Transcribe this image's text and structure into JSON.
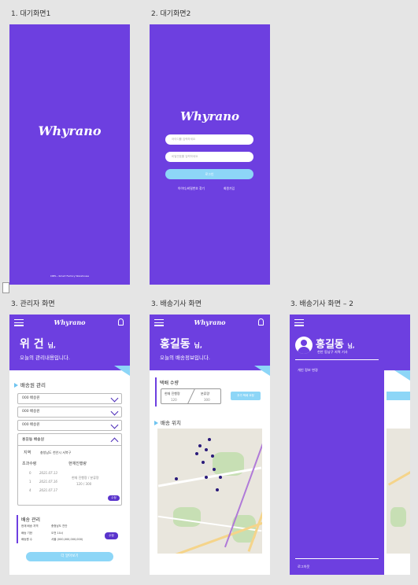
{
  "labels": {
    "s1": "1. 대기화면1",
    "s2": "2. 대기화면2",
    "s3": "3. 관리자 화면",
    "s4": "3. 배송기사 화면",
    "s5": "3. 배송기사 화면 – 2"
  },
  "app": {
    "logo": "Whyrano"
  },
  "splash": {
    "footer": "CREL...Smart Factory Warehouse"
  },
  "login": {
    "id_placeholder": "아이디를 입력하세요",
    "pw_placeholder": "비밀번호를 입력하세요",
    "login_button": "로그인",
    "find_link": "아이디/비밀번호 찾기",
    "signup_link": "회원가입"
  },
  "admin": {
    "name": "위 건",
    "suffix": "님,",
    "subtitle": "오늘의 관리내용입니다.",
    "section_drivers": "배송원 관리",
    "dropdowns": [
      "000 배송원",
      "000 배송원",
      "000 배송원"
    ],
    "expanded": {
      "title": "홍길동 배송원",
      "region_label": "지역",
      "region_value": "충청남도 천안시 서북구",
      "overtime_label": "초과수령",
      "progress_label": "현재진행량",
      "rows": [
        {
          "no": "0",
          "date": "2021.07.13"
        },
        {
          "no": "1",
          "date": "2021.07.16"
        },
        {
          "no": "4",
          "date": "2021.07.17"
        }
      ],
      "progress_head": "현재 진행량  /  분류량",
      "progress_vals": "120  /  300",
      "edit_button": "수정"
    },
    "section_delivery": "배송 관리",
    "delivery_lines": [
      {
        "k": "현재 배송 지역",
        "v": "충청남도 천안"
      },
      {
        "k": "배송 기한",
        "v": "오전 10시"
      },
      {
        "k": "배송원 수",
        "v": "서울 (000,000,000,000)"
      }
    ],
    "delivery_edit": "수정",
    "bottom_button": "더 알아보기"
  },
  "driver": {
    "name": "홍길동",
    "suffix": "님,",
    "subtitle": "오늘의 배송정보입니다.",
    "parcel_title": "택배 수량",
    "box_left_label": "현재 진행량",
    "box_left_val": "120",
    "box_right_label": "분류량",
    "box_right_val": "300",
    "request_button": "추가 택배 요청",
    "location_title": "배송 위치"
  },
  "drawer": {
    "name": "홍길동",
    "suffix": "님,",
    "region": "천안 동남구 지역 기사",
    "menu_item": "개인 정보 변경",
    "logout": "로그아웃"
  },
  "colors": {
    "primary": "#6d3fe0",
    "accent": "#8dd6f7"
  }
}
